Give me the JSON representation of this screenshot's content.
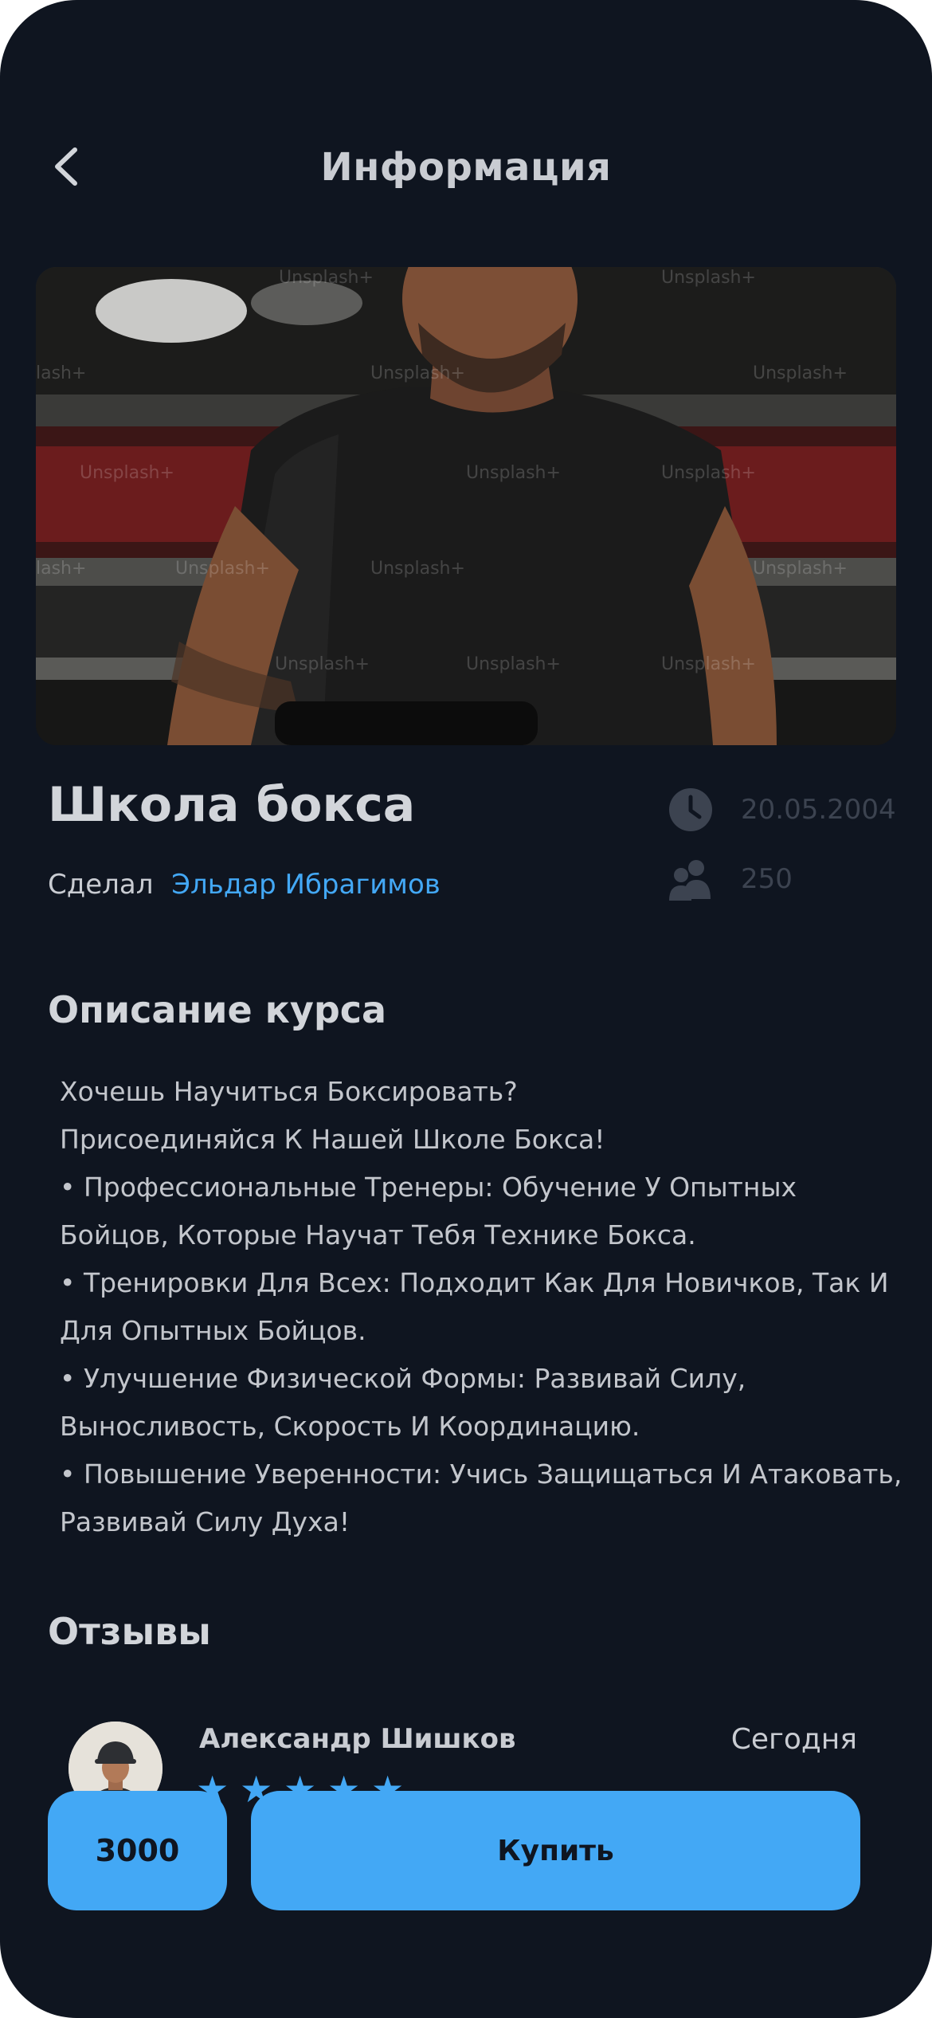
{
  "header": {
    "title": "Информация",
    "back_icon": "chevron-left-icon"
  },
  "hero": {
    "watermark": "Unsplash+"
  },
  "course": {
    "title": "Школа бокса",
    "author_prefix": "Сделал",
    "author_name": "Эльдар Ибрагимов",
    "date": "20.05.2004",
    "participants": "250"
  },
  "description": {
    "title": "Описание курса",
    "lines": [
      "Хочешь Научиться Боксировать?",
      "Присоединяйся К Нашей Школе Бокса!",
      "• Профессиональные Тренеры: Обучение У Опытных",
      "Бойцов, Которые Научат Тебя Технике Бокса.",
      "• Тренировки Для Всех: Подходит Как Для Новичков, Так И",
      "Для Опытных Бойцов.",
      "• Улучшение Физической Формы: Развивай Силу,",
      "Выносливость, Скорость И Координацию.",
      "• Повышение Уверенности: Учись Защищаться И Атаковать,",
      "Развивай Силу Духа!"
    ]
  },
  "reviews": {
    "title": "Отзывы",
    "items": [
      {
        "name": "Александр Шишков",
        "date": "Сегодня",
        "rating": 5
      }
    ]
  },
  "footer": {
    "price": "3000",
    "buy_label": "Купить"
  },
  "colors": {
    "background": "#0f1520",
    "accent": "#43a8f5",
    "text": "#c9ccd2",
    "muted": "#3c4350"
  }
}
